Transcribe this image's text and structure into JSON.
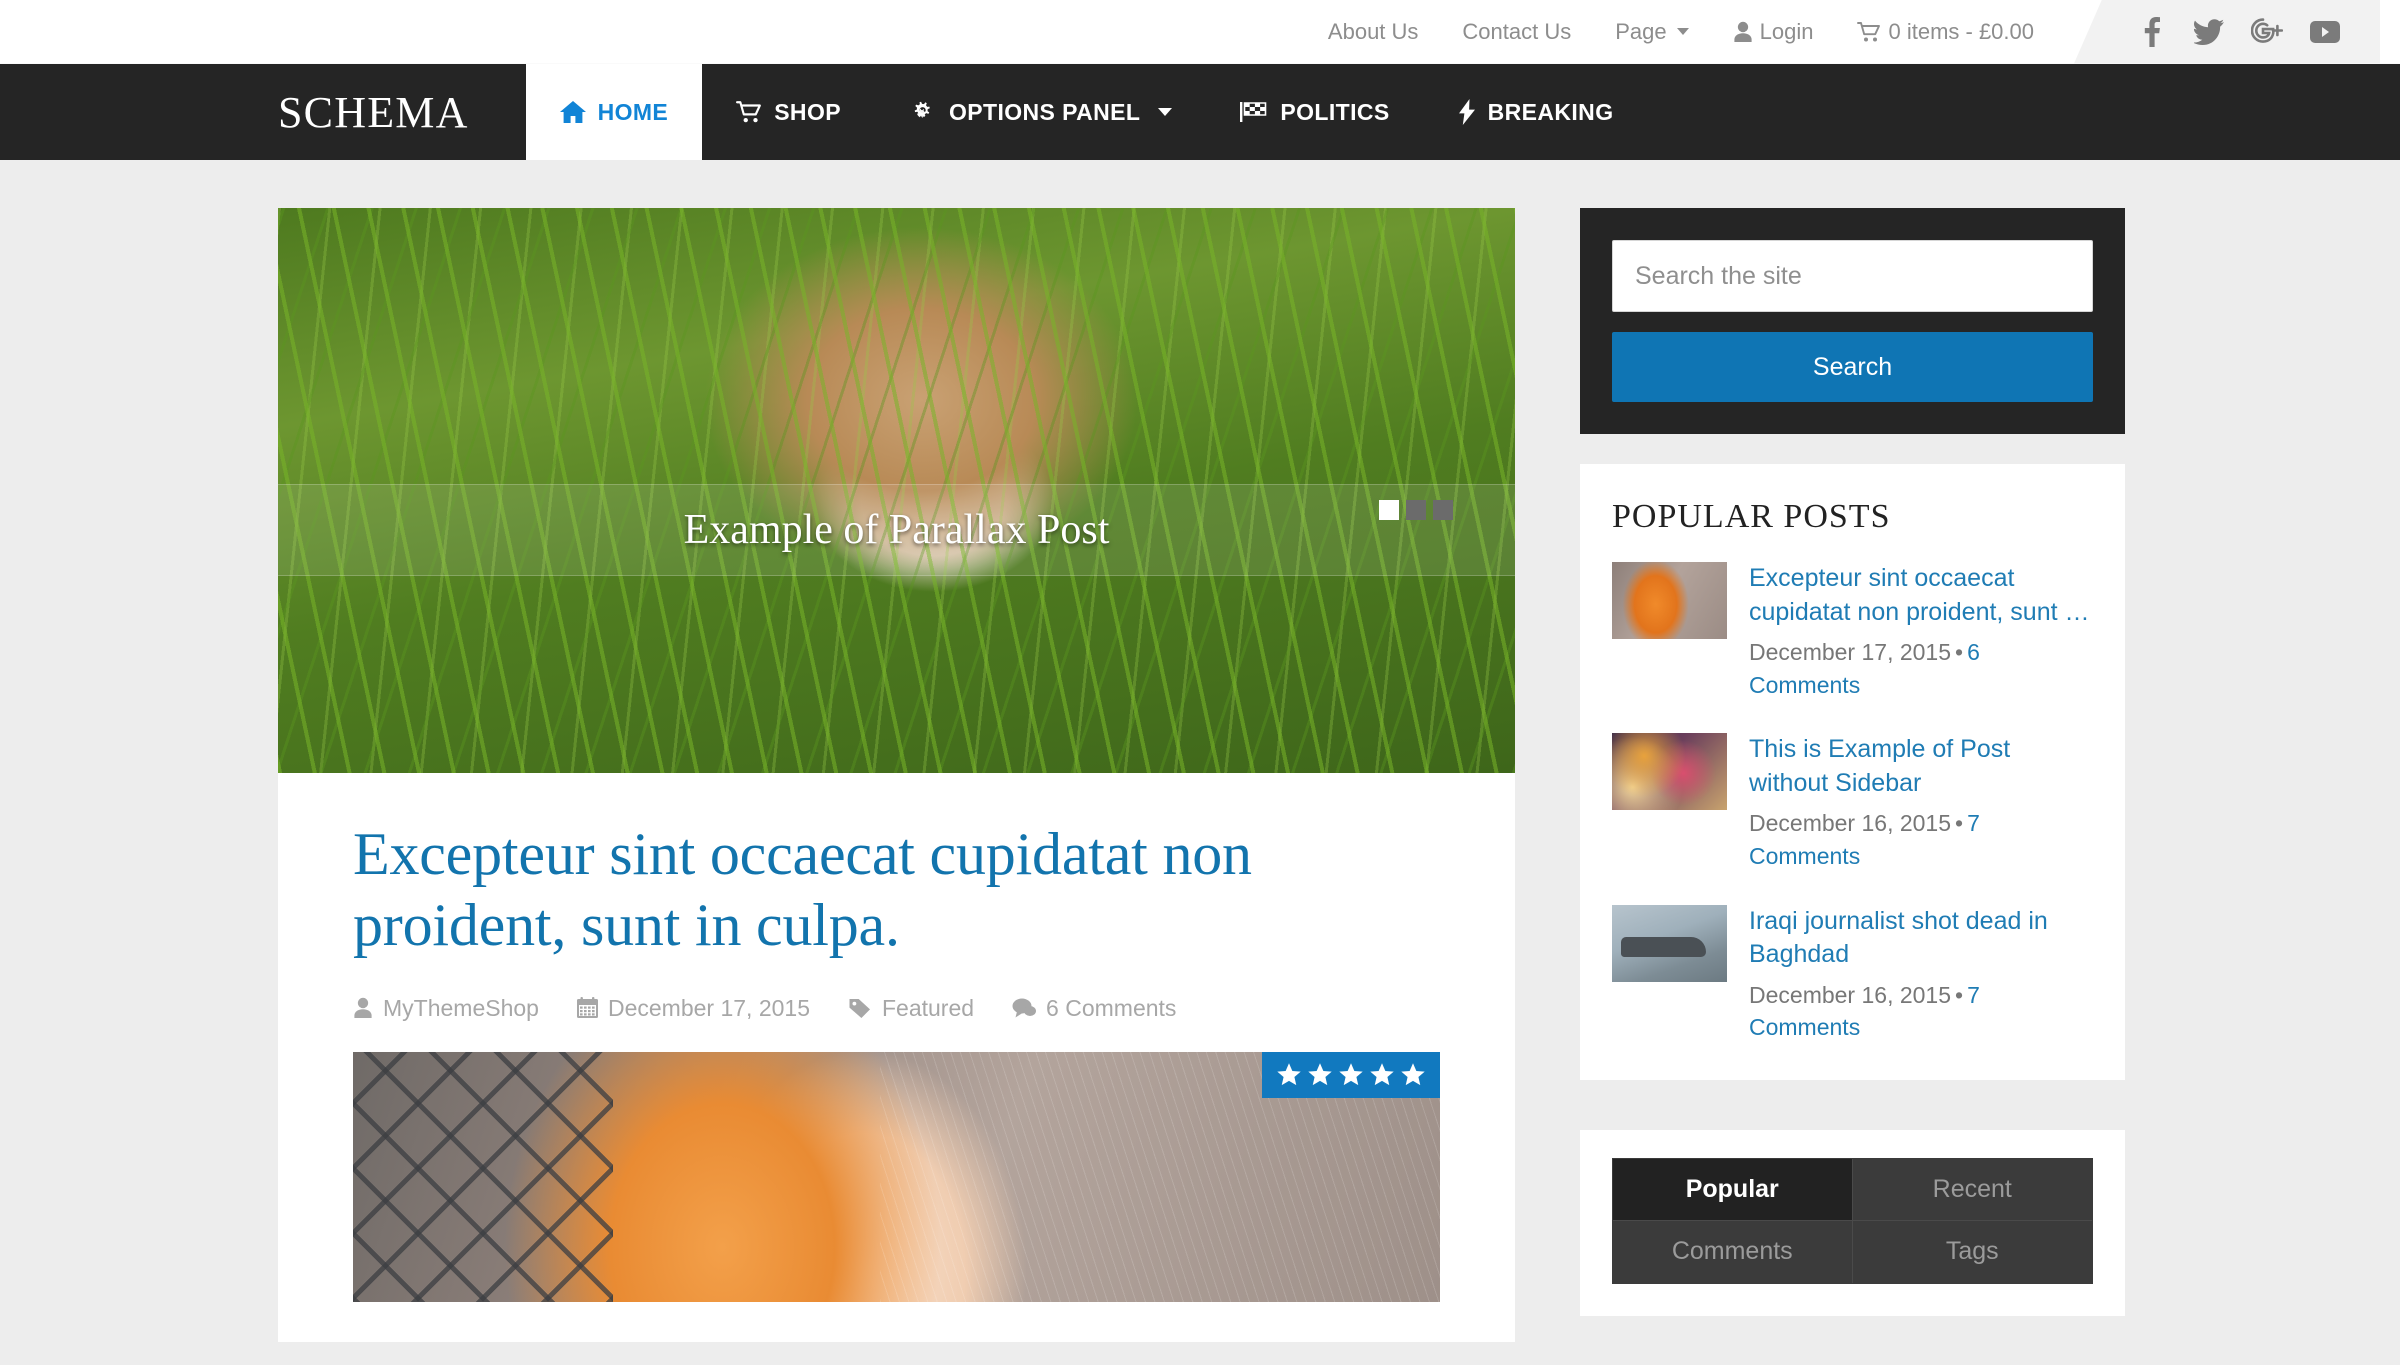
{
  "topbar": {
    "links": [
      {
        "label": "About Us",
        "icon": null,
        "caret": false
      },
      {
        "label": "Contact Us",
        "icon": null,
        "caret": false
      },
      {
        "label": "Page",
        "icon": null,
        "caret": true
      },
      {
        "label": "Login",
        "icon": "user-icon",
        "caret": false
      },
      {
        "label": "0 items - £0.00",
        "icon": "cart-icon",
        "caret": false
      }
    ],
    "social": [
      {
        "name": "facebook-icon"
      },
      {
        "name": "twitter-icon"
      },
      {
        "name": "google-plus-icon"
      },
      {
        "name": "youtube-icon"
      }
    ]
  },
  "header": {
    "logo": "SCHEMA",
    "nav": [
      {
        "label": "HOME",
        "icon": "home-icon",
        "active": true,
        "caret": false
      },
      {
        "label": "SHOP",
        "icon": "cart-icon",
        "active": false,
        "caret": false
      },
      {
        "label": "OPTIONS PANEL",
        "icon": "gears-icon",
        "active": false,
        "caret": true
      },
      {
        "label": "POLITICS",
        "icon": "flag-icon",
        "active": false,
        "caret": false
      },
      {
        "label": "BREAKING",
        "icon": "bolt-icon",
        "active": false,
        "caret": false
      }
    ]
  },
  "hero": {
    "caption": "Example of Parallax Post",
    "slides": 3,
    "active_slide": 0
  },
  "article": {
    "title": "Excepteur sint occaecat cupidatat non proident, sunt in culpa.",
    "meta": {
      "author": "MyThemeShop",
      "date": "December 17, 2015",
      "category": "Featured",
      "comments": "6 Comments"
    },
    "rating_stars": 5
  },
  "sidebar": {
    "search": {
      "placeholder": "Search the site",
      "value": "",
      "button_label": "Search"
    },
    "popular": {
      "title": "POPULAR POSTS",
      "items": [
        {
          "title": "Excepteur sint occaecat cupidatat non proident, sunt …",
          "date": "December 17, 2015",
          "comments": "6 Comments"
        },
        {
          "title": "This is Example of Post without Sidebar",
          "date": "December 16, 2015",
          "comments": "7 Comments"
        },
        {
          "title": "Iraqi journalist shot dead in Baghdad",
          "date": "December 16, 2015",
          "comments": "7 Comments"
        }
      ]
    },
    "tabs": [
      {
        "label": "Popular",
        "active": true
      },
      {
        "label": "Recent",
        "active": false
      },
      {
        "label": "Comments",
        "active": false
      },
      {
        "label": "Tags",
        "active": false
      }
    ]
  },
  "colors": {
    "accent_blue": "#0f75b4",
    "link_blue": "#1f7cb4",
    "header_dark": "#252525",
    "page_bg": "#ededed"
  }
}
